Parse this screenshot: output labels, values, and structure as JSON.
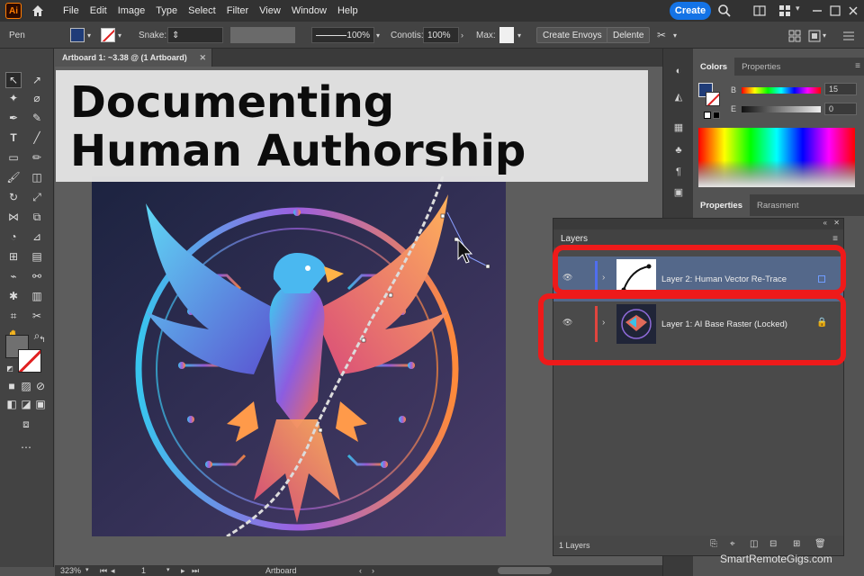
{
  "app": {
    "logo_text": "Ai",
    "menu": [
      "File",
      "Edit",
      "Image",
      "Type",
      "Select",
      "Filter",
      "View",
      "Window",
      "Help"
    ],
    "create_label": "Create"
  },
  "controlbar": {
    "tool_name": "Pen",
    "snake_label": "Snake:",
    "stroke_value": "100%",
    "constits_label": "Conotis:",
    "constits_value": "100%",
    "max_label": "Max:",
    "create_envoys_label": "Create Envoys",
    "delente_label": "Delente"
  },
  "document": {
    "tab_label": "Artboard 1: ~3.38 @ (1 Artboard)"
  },
  "overlay": {
    "line1": "Documenting",
    "line2": "Human Authorship"
  },
  "colors_panel": {
    "tabs": [
      "Colors",
      "Properties"
    ],
    "b_label": "B",
    "b_value": "15",
    "e_label": "E",
    "e_value": "0"
  },
  "properties_panel": {
    "tabs": [
      "Properties",
      "Rarasment"
    ]
  },
  "layers": {
    "tab_label": "Layers",
    "rows": [
      {
        "name": "Layer 2: Human Vector Re-Trace",
        "color": "#4f6ef0",
        "highlighted": true
      },
      {
        "name": "Layer 1: AI Base Raster (Locked)",
        "color": "#e0453f",
        "highlighted": true
      }
    ],
    "count_label": "1 Layers"
  },
  "status": {
    "zoom": "323%",
    "page": "1",
    "mode": "Artboard"
  },
  "watermark": "SmartRemoteGigs.com",
  "colors": {
    "accent": "#1473e6",
    "highlight_red": "#ee1a1a",
    "menubar_bg": "#323232",
    "panel_bg": "#535353"
  }
}
